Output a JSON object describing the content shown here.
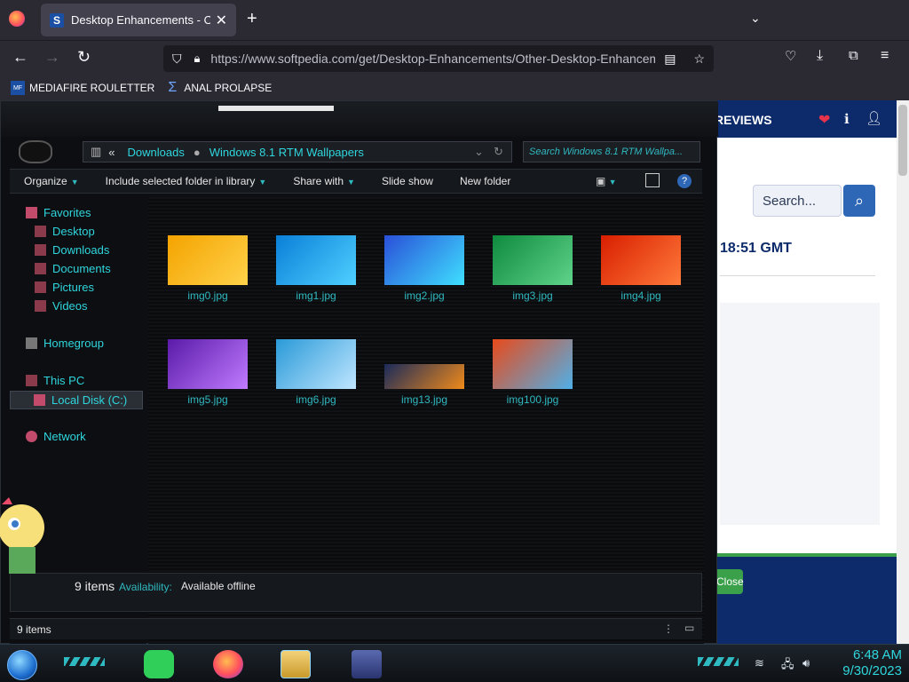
{
  "browser": {
    "tab_title": "Desktop Enhancements - Other Desktop Enhancements",
    "favicon_letter": "S",
    "new_tab": "+",
    "tab_close": "✕",
    "url": "https://www.softpedia.com/get/Desktop-Enhancements/Other-Desktop-Enhancements/",
    "url_domain": "softpedia.com",
    "bookmarks": [
      {
        "label": "MEDIAFIRE ROULETTER",
        "icon": "mf-icon"
      },
      {
        "label": "ANAL PROLAPSE",
        "icon": "sigma-icon"
      }
    ]
  },
  "webpage": {
    "nav_text": "REVIEWS",
    "search_placeholder": "Search...",
    "time_text": "18:51 GMT",
    "green_button": "Close"
  },
  "explorer": {
    "address": {
      "root_glyph": "«",
      "segments": [
        "Downloads",
        "Windows 8.1 RTM Wallpapers"
      ]
    },
    "search_placeholder": "Search Windows 8.1 RTM Wallpa...",
    "toolbar": {
      "organize": "Organize",
      "include": "Include selected folder in library",
      "share": "Share with",
      "slideshow": "Slide show",
      "newfolder": "New folder"
    },
    "nav": {
      "favorites": "Favorites",
      "desktop": "Desktop",
      "downloads": "Downloads",
      "documents": "Documents",
      "pictures": "Pictures",
      "videos": "Videos",
      "homegroup": "Homegroup",
      "thispc": "This PC",
      "localdisk": "Local Disk (C:)",
      "network": "Network"
    },
    "files": [
      {
        "name": "img0.jpg",
        "colors": [
          "#f4a300",
          "#ffd24a"
        ]
      },
      {
        "name": "img1.jpg",
        "colors": [
          "#0a7fd8",
          "#4fd0ff"
        ]
      },
      {
        "name": "img2.jpg",
        "colors": [
          "#2a4fd8",
          "#3fe0ff"
        ]
      },
      {
        "name": "img3.jpg",
        "colors": [
          "#0e8a3e",
          "#5fd38a"
        ]
      },
      {
        "name": "img4.jpg",
        "colors": [
          "#d81e00",
          "#ff7a3a"
        ]
      },
      {
        "name": "img5.jpg",
        "colors": [
          "#5a1aa8",
          "#c07bff"
        ]
      },
      {
        "name": "img6.jpg",
        "colors": [
          "#2a9ad8",
          "#bfe6ff"
        ]
      },
      {
        "name": "img13.jpg",
        "colors": [
          "#1a2a5a",
          "#f08a1a"
        ]
      },
      {
        "name": "img100.jpg",
        "colors": [
          "#e84a1a",
          "#4fb0e8"
        ]
      }
    ],
    "details": {
      "count": "9 items",
      "availability_label": "Availability:",
      "availability_value": "Available offline"
    },
    "status": "9 items"
  },
  "taskbar": {
    "time": "6:48 AM",
    "date": "9/30/2023"
  }
}
